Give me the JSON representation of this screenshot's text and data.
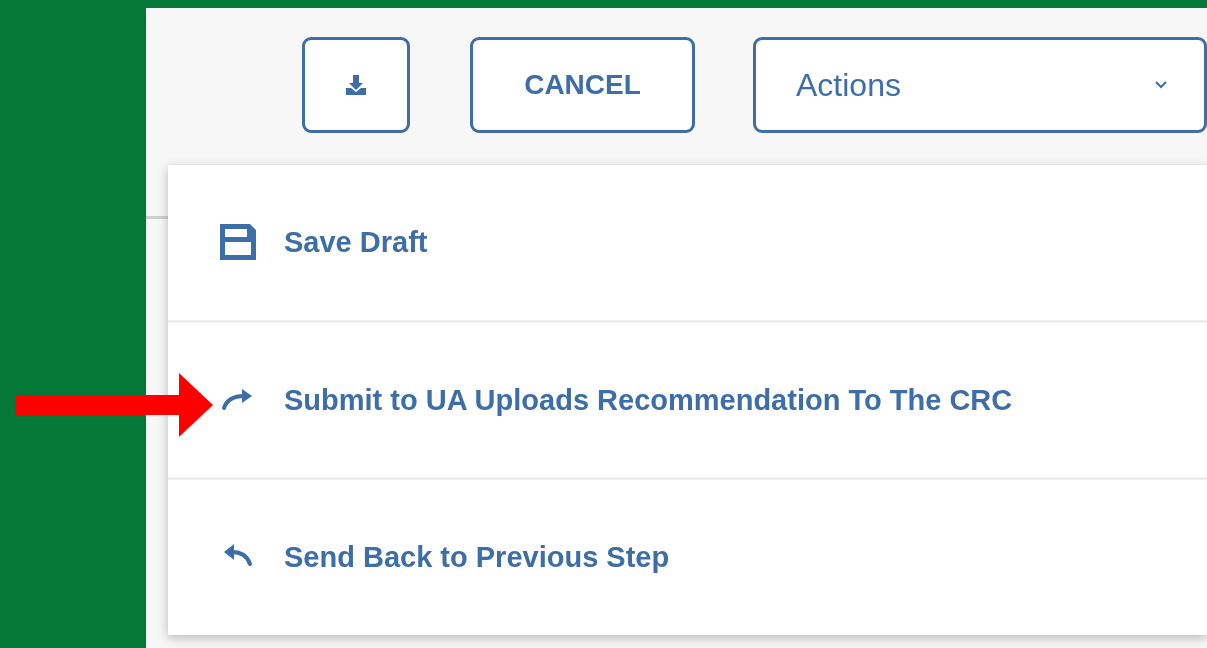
{
  "toolbar": {
    "cancel_button": "CANCEL",
    "actions_dropdown": {
      "label": "Actions",
      "expanded": true
    }
  },
  "actions_menu": [
    {
      "kind": "save",
      "label": "Save Draft"
    },
    {
      "kind": "forward",
      "label": "Submit to UA Uploads Recommendation To The CRC"
    },
    {
      "kind": "back",
      "label": "Send Back to Previous Step"
    }
  ]
}
